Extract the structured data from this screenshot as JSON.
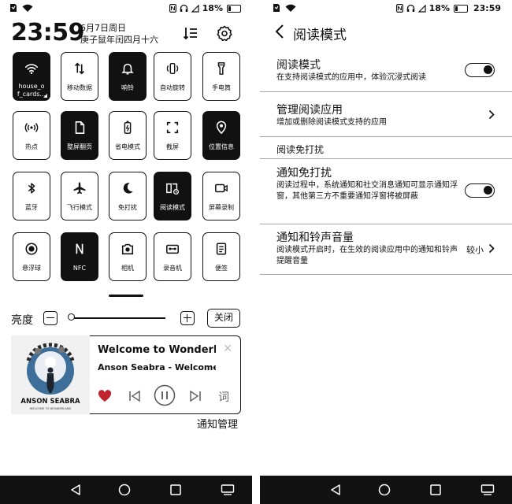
{
  "status_bar": {
    "battery": "18%",
    "time": "23:59"
  },
  "left_panel": {
    "clock": "23:59",
    "date_line1": "6月7日周日",
    "date_line2": "庚子鼠年闰四月十六",
    "tiles": [
      {
        "label": "house_o\nf_cards...",
        "icon": "wifi-icon",
        "active": true
      },
      {
        "label": "移动数据",
        "icon": "mobile-data-icon",
        "active": false
      },
      {
        "label": "响铃",
        "icon": "bell-icon",
        "active": true
      },
      {
        "label": "自动旋转",
        "icon": "rotate-icon",
        "active": false
      },
      {
        "label": "手电筒",
        "icon": "flashlight-icon",
        "active": false
      },
      {
        "label": "热点",
        "icon": "hotspot-icon",
        "active": false
      },
      {
        "label": "整屏翻页",
        "icon": "page-icon",
        "active": true
      },
      {
        "label": "省电模式",
        "icon": "battery-saver-icon",
        "active": false
      },
      {
        "label": "截屏",
        "icon": "screenshot-icon",
        "active": false
      },
      {
        "label": "位置信息",
        "icon": "location-icon",
        "active": true
      },
      {
        "label": "蓝牙",
        "icon": "bluetooth-icon",
        "active": false
      },
      {
        "label": "飞行模式",
        "icon": "airplane-icon",
        "active": false
      },
      {
        "label": "免打扰",
        "icon": "moon-icon",
        "active": false
      },
      {
        "label": "阅读模式",
        "icon": "reading-mode-icon",
        "active": true
      },
      {
        "label": "屏幕录制",
        "icon": "screen-record-icon",
        "active": false
      },
      {
        "label": "悬浮球",
        "icon": "float-ball-icon",
        "active": false
      },
      {
        "label": "NFC",
        "icon": "nfc-icon",
        "active": true
      },
      {
        "label": "相机",
        "icon": "camera-icon",
        "active": false
      },
      {
        "label": "录音机",
        "icon": "recorder-icon",
        "active": false
      },
      {
        "label": "便签",
        "icon": "notes-icon",
        "active": false
      }
    ],
    "brightness_label": "亮度",
    "brightness_level": 0.0,
    "close_label": "关闭",
    "music": {
      "title": "Welcome to Wonderla...",
      "artist": "Anson Seabra - Welcome t...",
      "album_text": "ANSON SEABRA",
      "album_subtext": "WELCOME TO WONDERLAND",
      "lyrics_label": "词"
    },
    "notification_manage": "通知管理"
  },
  "right_panel": {
    "title": "阅读模式",
    "rows": [
      {
        "title": "阅读模式",
        "desc": "在支持阅读模式的应用中，体验沉浸式阅读",
        "control": "switch-on"
      },
      {
        "title": "管理阅读应用",
        "desc": "增加或删除阅读模式支持的应用",
        "control": "chevron"
      }
    ],
    "section": "阅读免打扰",
    "rows2": [
      {
        "title": "通知免打扰",
        "desc": "阅读过程中，系统通知和社交消息通知可显示通知浮窗，其他第三方不重要通知浮窗将被屏蔽",
        "control": "switch-on"
      },
      {
        "title": "通知和铃声音量",
        "desc": "阅读模式开启时，在生效的阅读应用中的通知和铃声提醒音量",
        "value": "较小",
        "control": "chevron"
      }
    ]
  }
}
